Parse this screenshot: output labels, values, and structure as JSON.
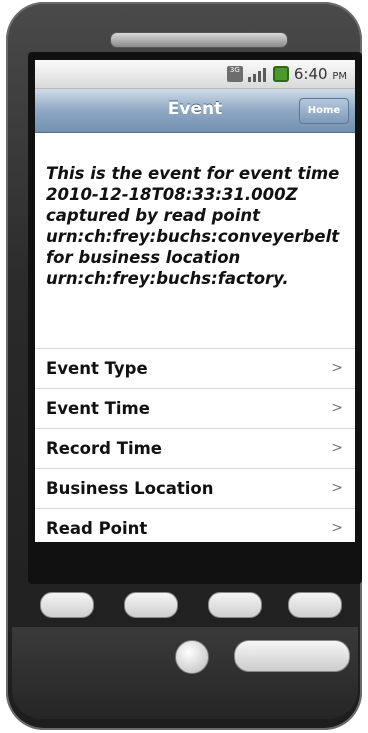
{
  "status": {
    "network_label": "3G",
    "time": "6:40",
    "ampm": "PM"
  },
  "header": {
    "title": "Event",
    "home_label": "Home"
  },
  "description": "This is the event for event time 2010-12-18T08:33:31.000Z captured by read point urn:ch:frey:buchs:conveyerbelt for business location urn:ch:frey:buchs:factory.",
  "menu": {
    "items": [
      {
        "label": "Event Type",
        "chevron": ">"
      },
      {
        "label": "Event Time",
        "chevron": ">"
      },
      {
        "label": "Record Time",
        "chevron": ">"
      },
      {
        "label": "Business Location",
        "chevron": ">"
      },
      {
        "label": "Read Point",
        "chevron": ">"
      }
    ]
  }
}
